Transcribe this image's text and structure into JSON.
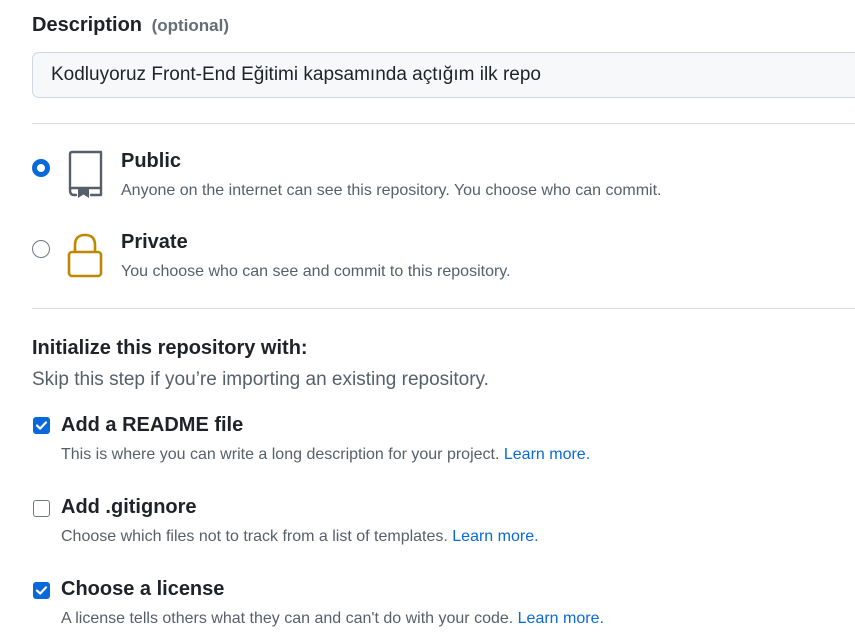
{
  "description": {
    "label": "Description",
    "optional": "(optional)",
    "value": "Kodluyoruz Front-End Eğitimi kapsamında açtığım ilk repo"
  },
  "visibility": {
    "selected": "public",
    "options": [
      {
        "key": "public",
        "icon": "repo-icon",
        "title": "Public",
        "description": "Anyone on the internet can see this repository. You choose who can commit."
      },
      {
        "key": "private",
        "icon": "lock-icon",
        "title": "Private",
        "description": "You choose who can see and commit to this repository."
      }
    ]
  },
  "initialize": {
    "title": "Initialize this repository with:",
    "subtitle": "Skip this step if you’re importing an existing repository.",
    "options": [
      {
        "title": "Add a README file",
        "checked": true,
        "description": "This is where you can write a long description for your project.",
        "link": "Learn more."
      },
      {
        "title": "Add .gitignore",
        "checked": false,
        "description": "Choose which files not to track from a list of templates.",
        "link": "Learn more."
      },
      {
        "title": "Choose a license",
        "checked": true,
        "description": "A license tells others what they can and can't do with your code.",
        "link": "Learn more."
      }
    ]
  },
  "colors": {
    "accent": "#0969da",
    "lock_icon": "#bf8700",
    "muted_text": "#57606a"
  }
}
